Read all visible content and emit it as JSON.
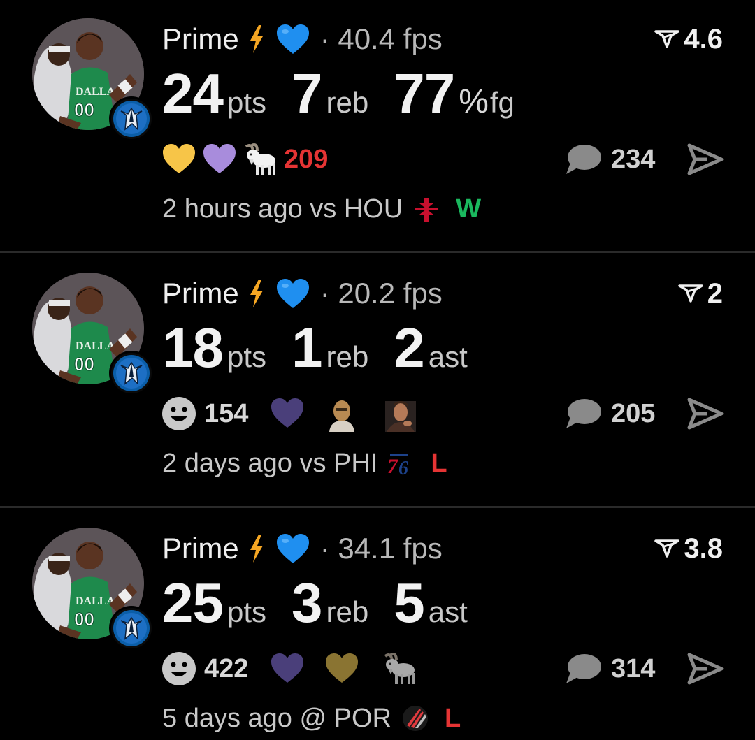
{
  "posts": [
    {
      "user": "Prime",
      "fps": "· 40.4 fps",
      "rating": "4.6",
      "stats": [
        {
          "value": "24",
          "unit": "pts"
        },
        {
          "value": "7",
          "unit": "reb"
        },
        {
          "value": "77",
          "unit": "fg",
          "pct": "%"
        }
      ],
      "reactions": [
        {
          "icon": "yellow-heart-icon",
          "count": ""
        },
        {
          "icon": "purple-heart-icon",
          "count": ""
        },
        {
          "icon": "goat-icon",
          "count": "209"
        }
      ],
      "comments": "234",
      "time": "2 hours ago vs HOU",
      "opponent_logo": "rockets-logo-icon",
      "result": "W"
    },
    {
      "user": "Prime",
      "fps": "· 20.2 fps",
      "rating": "2",
      "stats": [
        {
          "value": "18",
          "unit": "pts"
        },
        {
          "value": "1",
          "unit": "reb"
        },
        {
          "value": "2",
          "unit": "ast"
        }
      ],
      "reactions": [
        {
          "icon": "smiley-icon",
          "count": "154"
        },
        {
          "icon": "purple-heart-icon",
          "count": ""
        },
        {
          "icon": "masked-face-sticker-icon",
          "count": ""
        },
        {
          "icon": "man-face-sticker-icon",
          "count": ""
        }
      ],
      "comments": "205",
      "time": "2 days ago vs PHI",
      "opponent_logo": "76ers-logo-icon",
      "result": "L"
    },
    {
      "user": "Prime",
      "fps": "· 34.1 fps",
      "rating": "3.8",
      "stats": [
        {
          "value": "25",
          "unit": "pts"
        },
        {
          "value": "3",
          "unit": "reb"
        },
        {
          "value": "5",
          "unit": "ast"
        }
      ],
      "reactions": [
        {
          "icon": "smiley-icon",
          "count": "422"
        },
        {
          "icon": "purple-heart-icon",
          "count": ""
        },
        {
          "icon": "gold-heart-icon",
          "count": ""
        },
        {
          "icon": "goat-icon",
          "count": ""
        }
      ],
      "comments": "314",
      "time": "5 days ago @ POR",
      "opponent_logo": "blazers-logo-icon",
      "result": "L"
    }
  ],
  "colors": {
    "win": "#1ab85e",
    "loss": "#e53434",
    "blue_heart": "#1f8ff0",
    "bolt": "#f5a623",
    "yellow_heart": "#f7c548",
    "purple_heart": "#a88cdc",
    "dark_purple_heart": "#4a3f7a",
    "gold_heart": "#8a7432"
  }
}
